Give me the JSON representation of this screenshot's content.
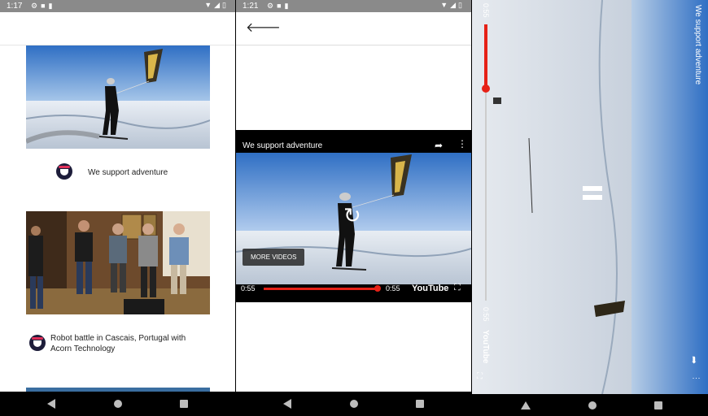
{
  "screen1": {
    "status_time": "1:17",
    "feed": [
      {
        "caption": "We support adventure"
      },
      {
        "caption": "Robot battle in Cascais, Portugal with Acorn Technology"
      }
    ]
  },
  "screen2": {
    "status_time": "1:21",
    "video": {
      "title": "We support adventure",
      "more_videos_label": "MORE VIDEOS",
      "time_elapsed": "0:55",
      "time_total": "0:55",
      "brand": "YouTube",
      "progress": 1.0
    }
  },
  "screen3": {
    "video_title": "We support adventure",
    "time_elapsed": "0:55",
    "time_total": "0:55",
    "brand": "YouTube",
    "progress": 0.22
  },
  "colors": {
    "accent_red": "#e62117",
    "status_bar": "#8a8a8a",
    "nav_bar": "#000000"
  },
  "icons": [
    "settings-icon",
    "notification-icon",
    "wifi-icon",
    "battery-icon",
    "back-arrow-icon",
    "share-icon",
    "more-vert-icon",
    "replay-icon",
    "fullscreen-icon",
    "pause-icon"
  ]
}
